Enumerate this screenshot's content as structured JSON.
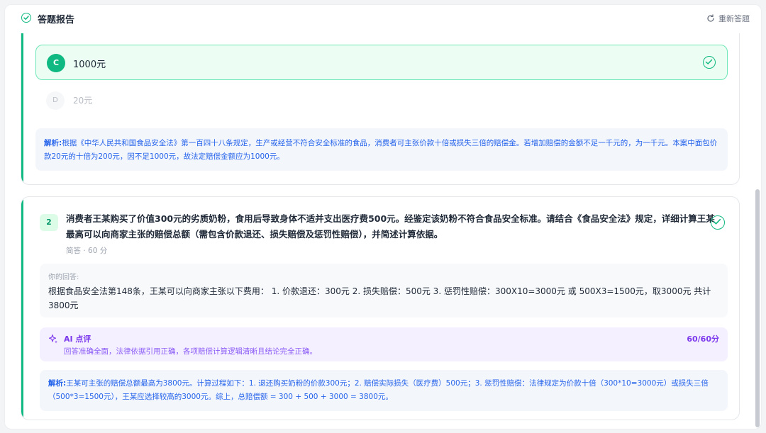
{
  "header": {
    "title": "答题报告",
    "restart_label": "重新答题"
  },
  "q1": {
    "option_c": {
      "letter": "C",
      "text": "1000元"
    },
    "option_d": {
      "letter": "D",
      "text": "20元"
    },
    "analysis_label": "解析:",
    "analysis_text": "根据《中华人民共和国食品安全法》第一百四十八条规定，生产或经营不符合安全标准的食品，消费者可主张价款十倍或损失三倍的赔偿金。若增加赔偿的金额不足一千元的，为一千元。本案中面包价款20元的十倍为200元，因不足1000元，故法定赔偿金额应为1000元。"
  },
  "q2": {
    "number": "2",
    "question": "消费者王某购买了价值300元的劣质奶粉，食用后导致身体不适并支出医疗费500元。经鉴定该奶粉不符合食品安全标准。请结合《食品安全法》规定，详细计算王某最高可以向商家主张的赔偿总额（需包含价款退还、损失赔偿及惩罚性赔偿），并简述计算依据。",
    "meta": "简答 · 60 分",
    "answer_label": "你的回答:",
    "answer_text": "根据食品安全法第148条，王某可以向商家主张以下费用： 1. 价款退还：300元 2. 损失赔偿：500元 3. 惩罚性赔偿：300X10=3000元 或 500X3=1500元，取3000元 共计3800元",
    "ai_title": "AI 点评",
    "ai_score": "60/60分",
    "ai_comment": "回答准确全面，法律依据引用正确，各项赔偿计算逻辑清晰且结论完全正确。",
    "analysis_label": "解析:",
    "analysis_text": "王某可主张的赔偿总额最高为3800元。计算过程如下：1. 退还购买奶粉的价款300元；2. 赔偿实际损失（医疗费）500元；3. 惩罚性赔偿：法律规定为价款十倍（300*10=3000元）或损失三倍（500*3=1500元），王某应选择较高的3000元。综上，总赔偿额 = 300 + 500 + 3000 = 3800元。"
  },
  "colors": {
    "accent_green": "#10b981",
    "analysis_blue": "#2563eb",
    "ai_purple": "#7c3aed"
  }
}
